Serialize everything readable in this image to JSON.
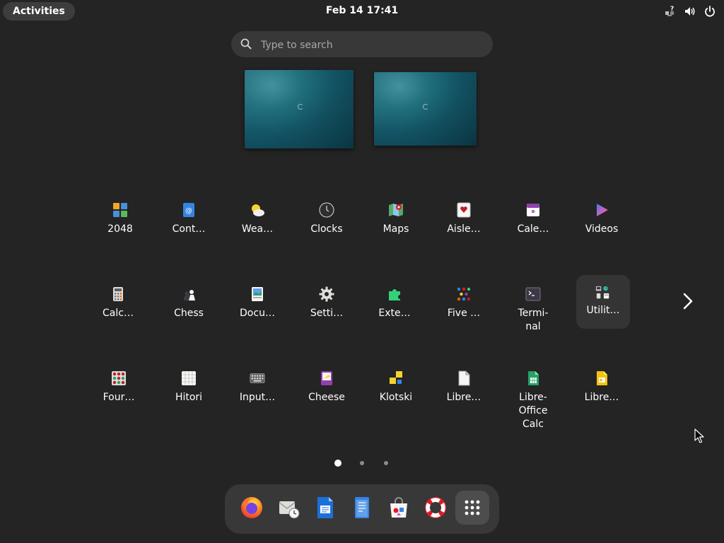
{
  "topbar": {
    "activities_label": "Activities",
    "clock": "Feb 14  17:41",
    "tray_icons": [
      "network-unknown-icon",
      "volume-icon",
      "power-icon"
    ]
  },
  "search": {
    "placeholder": "Type to search",
    "value": ""
  },
  "workspaces": [
    {
      "name": "workspace-1",
      "active": true
    },
    {
      "name": "workspace-2",
      "active": false
    }
  ],
  "app_grid": {
    "rows": [
      [
        {
          "label": "2048",
          "icon": "2048-icon"
        },
        {
          "label": "Cont…",
          "icon": "contacts-icon"
        },
        {
          "label": "Wea…",
          "icon": "weather-icon"
        },
        {
          "label": "Clocks",
          "icon": "clocks-icon"
        },
        {
          "label": "Maps",
          "icon": "maps-icon"
        },
        {
          "label": "Aisle…",
          "icon": "aisleriot-icon"
        },
        {
          "label": "Cale…",
          "icon": "calendar-icon"
        },
        {
          "label": "Videos",
          "icon": "videos-icon"
        }
      ],
      [
        {
          "label": "Calc…",
          "icon": "calculator-icon"
        },
        {
          "label": "Chess",
          "icon": "chess-icon"
        },
        {
          "label": "Docu…",
          "icon": "document-viewer-icon"
        },
        {
          "label": "Setti…",
          "icon": "settings-icon"
        },
        {
          "label": "Exte…",
          "icon": "extensions-icon"
        },
        {
          "label": "Five …",
          "icon": "five-or-more-icon"
        },
        {
          "label": "Termi-\nnal",
          "icon": "terminal-icon"
        },
        {
          "label": "Utilit…",
          "icon": "utilities-folder-icon",
          "selected": true
        }
      ],
      [
        {
          "label": "Four…",
          "icon": "four-in-a-row-icon"
        },
        {
          "label": "Hitori",
          "icon": "hitori-icon"
        },
        {
          "label": "Input…",
          "icon": "input-method-icon"
        },
        {
          "label": "Cheese",
          "icon": "cheese-icon"
        },
        {
          "label": "Klotski",
          "icon": "klotski-icon"
        },
        {
          "label": "Libre…",
          "icon": "libreoffice-icon"
        },
        {
          "label": "Libre-\nOffice\nCalc",
          "icon": "libreoffice-calc-icon"
        },
        {
          "label": "Libre…",
          "icon": "libreoffice-impress-icon"
        }
      ]
    ],
    "next_page_icon": "chevron-right-icon",
    "pages": {
      "count": 3,
      "current": 1
    }
  },
  "dash": {
    "items": [
      {
        "name": "firefox",
        "icon": "firefox-icon"
      },
      {
        "name": "evolution",
        "icon": "mail-clock-icon"
      },
      {
        "name": "libreoffice-writer",
        "icon": "writer-icon"
      },
      {
        "name": "text-editor",
        "icon": "text-editor-icon"
      },
      {
        "name": "software",
        "icon": "software-store-icon"
      },
      {
        "name": "help",
        "icon": "help-lifebuoy-icon"
      },
      {
        "name": "show-apps",
        "icon": "app-grid-icon",
        "active": true
      }
    ]
  },
  "colors": {
    "background": "#242424",
    "panel": "#383838",
    "selected_tile": "#343434",
    "text": "#ffffff",
    "placeholder": "#a8a8a8"
  }
}
